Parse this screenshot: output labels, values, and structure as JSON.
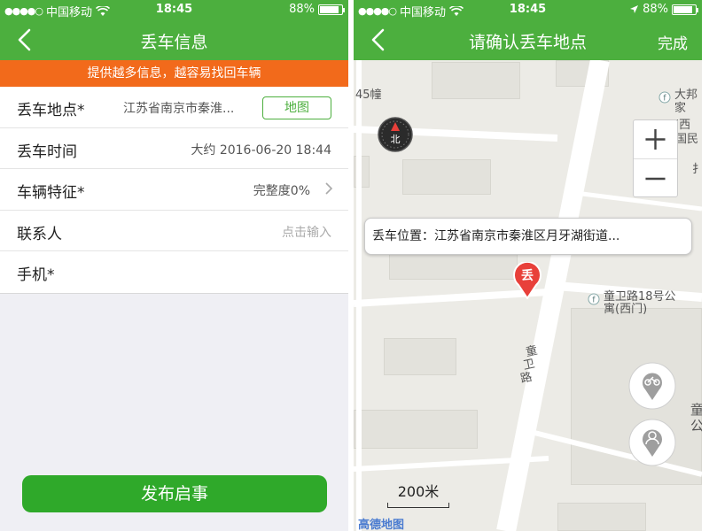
{
  "left_screen": {
    "status": {
      "carrier": "中国移动",
      "time": "18:45",
      "battery": "88%",
      "battery_level": 0.88
    },
    "nav": {
      "title": "丢车信息"
    },
    "banner": "提供越多信息，越容易找回车辆",
    "rows": [
      {
        "label": "丢车地点*",
        "value": "江苏省南京市秦淮...",
        "button": "地图"
      },
      {
        "label": "丢车时间",
        "value": "大约 2016-06-20 18:44"
      },
      {
        "label": "车辆特征*",
        "value": "完整度0%"
      },
      {
        "label": "联系人",
        "placeholder": "点击输入"
      },
      {
        "label": "手机*",
        "value": ""
      }
    ],
    "publish_button": "发布启事"
  },
  "right_screen": {
    "status": {
      "carrier": "中国移动",
      "time": "18:45",
      "battery": "88%",
      "battery_level": 0.88
    },
    "nav": {
      "title": "请确认丢车地点",
      "done": "完成"
    },
    "map": {
      "labels": {
        "building_45": "45幢",
        "dabang_1": "大邦",
        "dabang_2": "家(西",
        "zhongguo": "中国民",
        "tongwei_poi_1": "童卫路18号公",
        "tongwei_poi_2": "寓(西门)",
        "road_1": "童",
        "road_2": "卫",
        "road_3": "路",
        "edge_1": "童",
        "edge_2": "公",
        "edge_3": "扌"
      },
      "callout": "丢车位置：江苏省南京市秦淮区月牙湖街道...",
      "pin_label": "丢",
      "compass_label": "北",
      "zoom_in": "+",
      "zoom_out": "−",
      "scale": "200米",
      "logo": "高德地图"
    }
  },
  "colors": {
    "green": "#4caf3e",
    "orange": "#f26a1b",
    "button_green": "#2fa92a",
    "pin_red": "#e8403a"
  }
}
